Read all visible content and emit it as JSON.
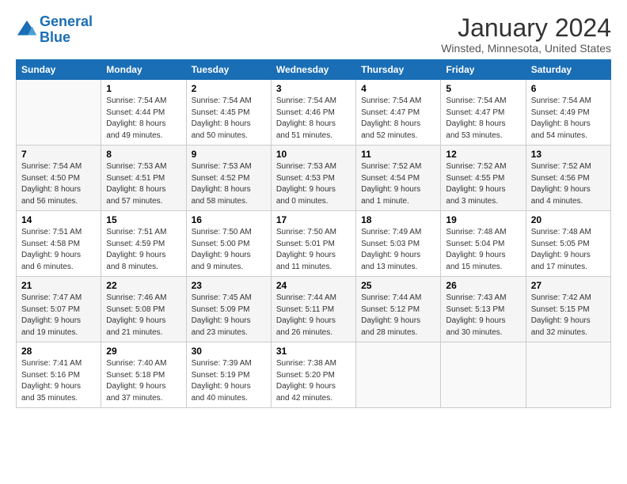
{
  "header": {
    "logo_line1": "General",
    "logo_line2": "Blue",
    "title": "January 2024",
    "subtitle": "Winsted, Minnesota, United States"
  },
  "days_of_week": [
    "Sunday",
    "Monday",
    "Tuesday",
    "Wednesday",
    "Thursday",
    "Friday",
    "Saturday"
  ],
  "weeks": [
    [
      {
        "day": "",
        "info": ""
      },
      {
        "day": "1",
        "info": "Sunrise: 7:54 AM\nSunset: 4:44 PM\nDaylight: 8 hours\nand 49 minutes."
      },
      {
        "day": "2",
        "info": "Sunrise: 7:54 AM\nSunset: 4:45 PM\nDaylight: 8 hours\nand 50 minutes."
      },
      {
        "day": "3",
        "info": "Sunrise: 7:54 AM\nSunset: 4:46 PM\nDaylight: 8 hours\nand 51 minutes."
      },
      {
        "day": "4",
        "info": "Sunrise: 7:54 AM\nSunset: 4:47 PM\nDaylight: 8 hours\nand 52 minutes."
      },
      {
        "day": "5",
        "info": "Sunrise: 7:54 AM\nSunset: 4:47 PM\nDaylight: 8 hours\nand 53 minutes."
      },
      {
        "day": "6",
        "info": "Sunrise: 7:54 AM\nSunset: 4:49 PM\nDaylight: 8 hours\nand 54 minutes."
      }
    ],
    [
      {
        "day": "7",
        "info": "Sunrise: 7:54 AM\nSunset: 4:50 PM\nDaylight: 8 hours\nand 56 minutes."
      },
      {
        "day": "8",
        "info": "Sunrise: 7:53 AM\nSunset: 4:51 PM\nDaylight: 8 hours\nand 57 minutes."
      },
      {
        "day": "9",
        "info": "Sunrise: 7:53 AM\nSunset: 4:52 PM\nDaylight: 8 hours\nand 58 minutes."
      },
      {
        "day": "10",
        "info": "Sunrise: 7:53 AM\nSunset: 4:53 PM\nDaylight: 9 hours\nand 0 minutes."
      },
      {
        "day": "11",
        "info": "Sunrise: 7:52 AM\nSunset: 4:54 PM\nDaylight: 9 hours\nand 1 minute."
      },
      {
        "day": "12",
        "info": "Sunrise: 7:52 AM\nSunset: 4:55 PM\nDaylight: 9 hours\nand 3 minutes."
      },
      {
        "day": "13",
        "info": "Sunrise: 7:52 AM\nSunset: 4:56 PM\nDaylight: 9 hours\nand 4 minutes."
      }
    ],
    [
      {
        "day": "14",
        "info": "Sunrise: 7:51 AM\nSunset: 4:58 PM\nDaylight: 9 hours\nand 6 minutes."
      },
      {
        "day": "15",
        "info": "Sunrise: 7:51 AM\nSunset: 4:59 PM\nDaylight: 9 hours\nand 8 minutes."
      },
      {
        "day": "16",
        "info": "Sunrise: 7:50 AM\nSunset: 5:00 PM\nDaylight: 9 hours\nand 9 minutes."
      },
      {
        "day": "17",
        "info": "Sunrise: 7:50 AM\nSunset: 5:01 PM\nDaylight: 9 hours\nand 11 minutes."
      },
      {
        "day": "18",
        "info": "Sunrise: 7:49 AM\nSunset: 5:03 PM\nDaylight: 9 hours\nand 13 minutes."
      },
      {
        "day": "19",
        "info": "Sunrise: 7:48 AM\nSunset: 5:04 PM\nDaylight: 9 hours\nand 15 minutes."
      },
      {
        "day": "20",
        "info": "Sunrise: 7:48 AM\nSunset: 5:05 PM\nDaylight: 9 hours\nand 17 minutes."
      }
    ],
    [
      {
        "day": "21",
        "info": "Sunrise: 7:47 AM\nSunset: 5:07 PM\nDaylight: 9 hours\nand 19 minutes."
      },
      {
        "day": "22",
        "info": "Sunrise: 7:46 AM\nSunset: 5:08 PM\nDaylight: 9 hours\nand 21 minutes."
      },
      {
        "day": "23",
        "info": "Sunrise: 7:45 AM\nSunset: 5:09 PM\nDaylight: 9 hours\nand 23 minutes."
      },
      {
        "day": "24",
        "info": "Sunrise: 7:44 AM\nSunset: 5:11 PM\nDaylight: 9 hours\nand 26 minutes."
      },
      {
        "day": "25",
        "info": "Sunrise: 7:44 AM\nSunset: 5:12 PM\nDaylight: 9 hours\nand 28 minutes."
      },
      {
        "day": "26",
        "info": "Sunrise: 7:43 AM\nSunset: 5:13 PM\nDaylight: 9 hours\nand 30 minutes."
      },
      {
        "day": "27",
        "info": "Sunrise: 7:42 AM\nSunset: 5:15 PM\nDaylight: 9 hours\nand 32 minutes."
      }
    ],
    [
      {
        "day": "28",
        "info": "Sunrise: 7:41 AM\nSunset: 5:16 PM\nDaylight: 9 hours\nand 35 minutes."
      },
      {
        "day": "29",
        "info": "Sunrise: 7:40 AM\nSunset: 5:18 PM\nDaylight: 9 hours\nand 37 minutes."
      },
      {
        "day": "30",
        "info": "Sunrise: 7:39 AM\nSunset: 5:19 PM\nDaylight: 9 hours\nand 40 minutes."
      },
      {
        "day": "31",
        "info": "Sunrise: 7:38 AM\nSunset: 5:20 PM\nDaylight: 9 hours\nand 42 minutes."
      },
      {
        "day": "",
        "info": ""
      },
      {
        "day": "",
        "info": ""
      },
      {
        "day": "",
        "info": ""
      }
    ]
  ]
}
